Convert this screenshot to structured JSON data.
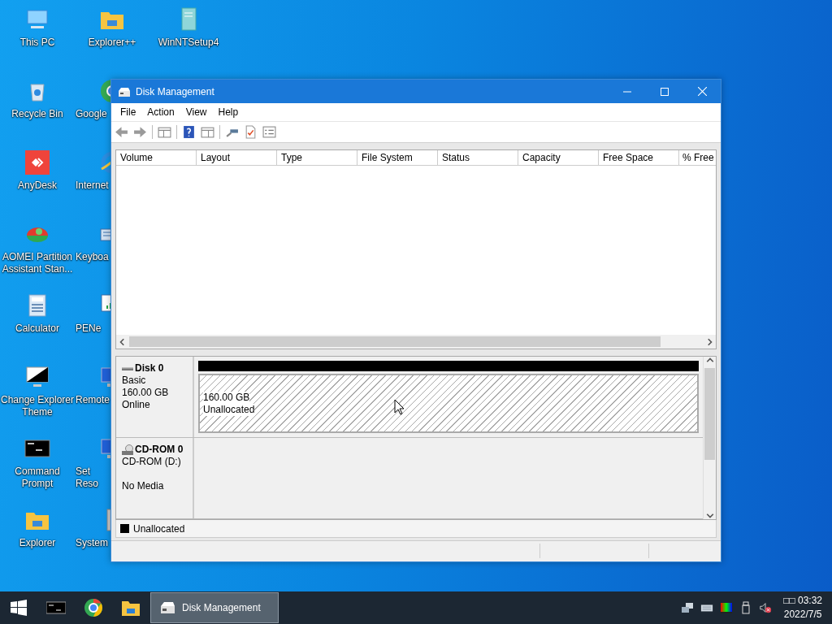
{
  "desktop": {
    "icons": [
      {
        "label": "This PC",
        "kind": "pc"
      },
      {
        "label": "Recycle Bin",
        "kind": "recycle"
      },
      {
        "label": "AnyDesk",
        "kind": "anydesk"
      },
      {
        "label": "AOMEI Partition Assistant Stan...",
        "kind": "aomei"
      },
      {
        "label": "Calculator",
        "kind": "calculator"
      },
      {
        "label": "Change Explorer Theme",
        "kind": "theme"
      },
      {
        "label": "Command Prompt",
        "kind": "cmd"
      },
      {
        "label": "Explorer",
        "kind": "explorer"
      },
      {
        "label": "Explorer++",
        "kind": "folder"
      },
      {
        "label": "Google",
        "kind": "chrome"
      },
      {
        "label": "Internet",
        "kind": "ie"
      },
      {
        "label": "Keyboa",
        "kind": "keyboard"
      },
      {
        "label": "PENe",
        "kind": "network"
      },
      {
        "label": "Remote",
        "kind": "remote"
      },
      {
        "label": "Set Reso",
        "kind": "settings"
      },
      {
        "label": "System",
        "kind": "system"
      },
      {
        "label": "WinNTSetup4",
        "kind": "installer"
      }
    ]
  },
  "window": {
    "title": "Disk Management",
    "menu": [
      "File",
      "Action",
      "View",
      "Help"
    ],
    "columns": [
      "Volume",
      "Layout",
      "Type",
      "File System",
      "Status",
      "Capacity",
      "Free Space",
      "% Free"
    ],
    "disks": [
      {
        "name": "Disk 0",
        "kind": "hdd",
        "details": [
          "Basic",
          "160.00 GB",
          "Online"
        ],
        "partitions": [
          {
            "size": "160.00 GB",
            "status": "Unallocated"
          }
        ]
      },
      {
        "name": "CD-ROM 0",
        "kind": "cdrom",
        "details": [
          "CD-ROM (D:)"
        ],
        "media": "No Media"
      }
    ],
    "legend": [
      {
        "label": "Unallocated",
        "color": "#000000"
      }
    ]
  },
  "taskbar": {
    "buttons": [
      {
        "kind": "start",
        "selected": false
      },
      {
        "kind": "cmd",
        "selected": false
      },
      {
        "kind": "chrome",
        "selected": false
      },
      {
        "kind": "explorer",
        "selected": false
      },
      {
        "kind": "app",
        "label": "Disk Management",
        "selected": true
      }
    ],
    "clock": {
      "time": "□□ 03:32",
      "date": "2022/7/5"
    }
  }
}
